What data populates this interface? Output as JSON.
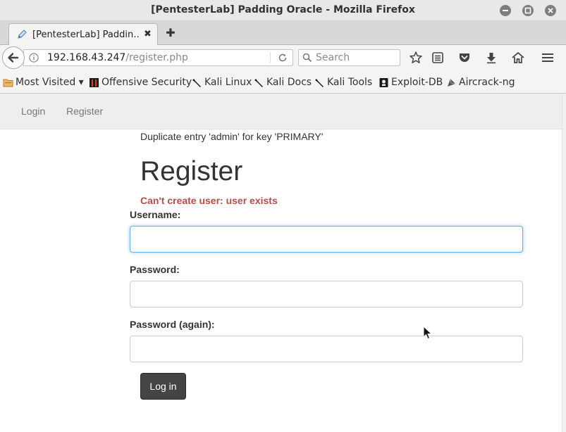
{
  "window": {
    "title": "[PentesterLab] Padding Oracle - Mozilla Firefox"
  },
  "tabs": [
    {
      "label": "[PentesterLab] Paddin…",
      "close": "✖"
    }
  ],
  "newtab": {
    "label": "✚"
  },
  "urlbar": {
    "host": "192.168.43.247",
    "path": "/register.php"
  },
  "search": {
    "placeholder": "Search"
  },
  "bookmarks": [
    {
      "label": "Most Visited ▾",
      "icon": "folder-icon"
    },
    {
      "label": "Offensive Security",
      "icon": "offsec-icon"
    },
    {
      "label": "Kali Linux",
      "icon": "kali-dragon-icon"
    },
    {
      "label": "Kali Docs",
      "icon": "kali-dragon-icon"
    },
    {
      "label": "Kali Tools",
      "icon": "kali-dragon-icon"
    },
    {
      "label": "Exploit-DB",
      "icon": "exploitdb-icon"
    },
    {
      "label": "Aircrack-ng",
      "icon": "aircrack-icon"
    }
  ],
  "sitenav": {
    "login": "Login",
    "register": "Register"
  },
  "main": {
    "sql_error": "Duplicate entry 'admin' for key 'PRIMARY'",
    "heading": "Register",
    "error": "Can't create user: user exists",
    "username_label": "Username:",
    "password_label": "Password:",
    "password_again_label": "Password (again):",
    "submit_label": "Log in",
    "username_value": "",
    "password_value": "",
    "password_again_value": ""
  },
  "colors": {
    "error": "#b94a48",
    "button": "#444444",
    "focus": "#66afe9"
  }
}
